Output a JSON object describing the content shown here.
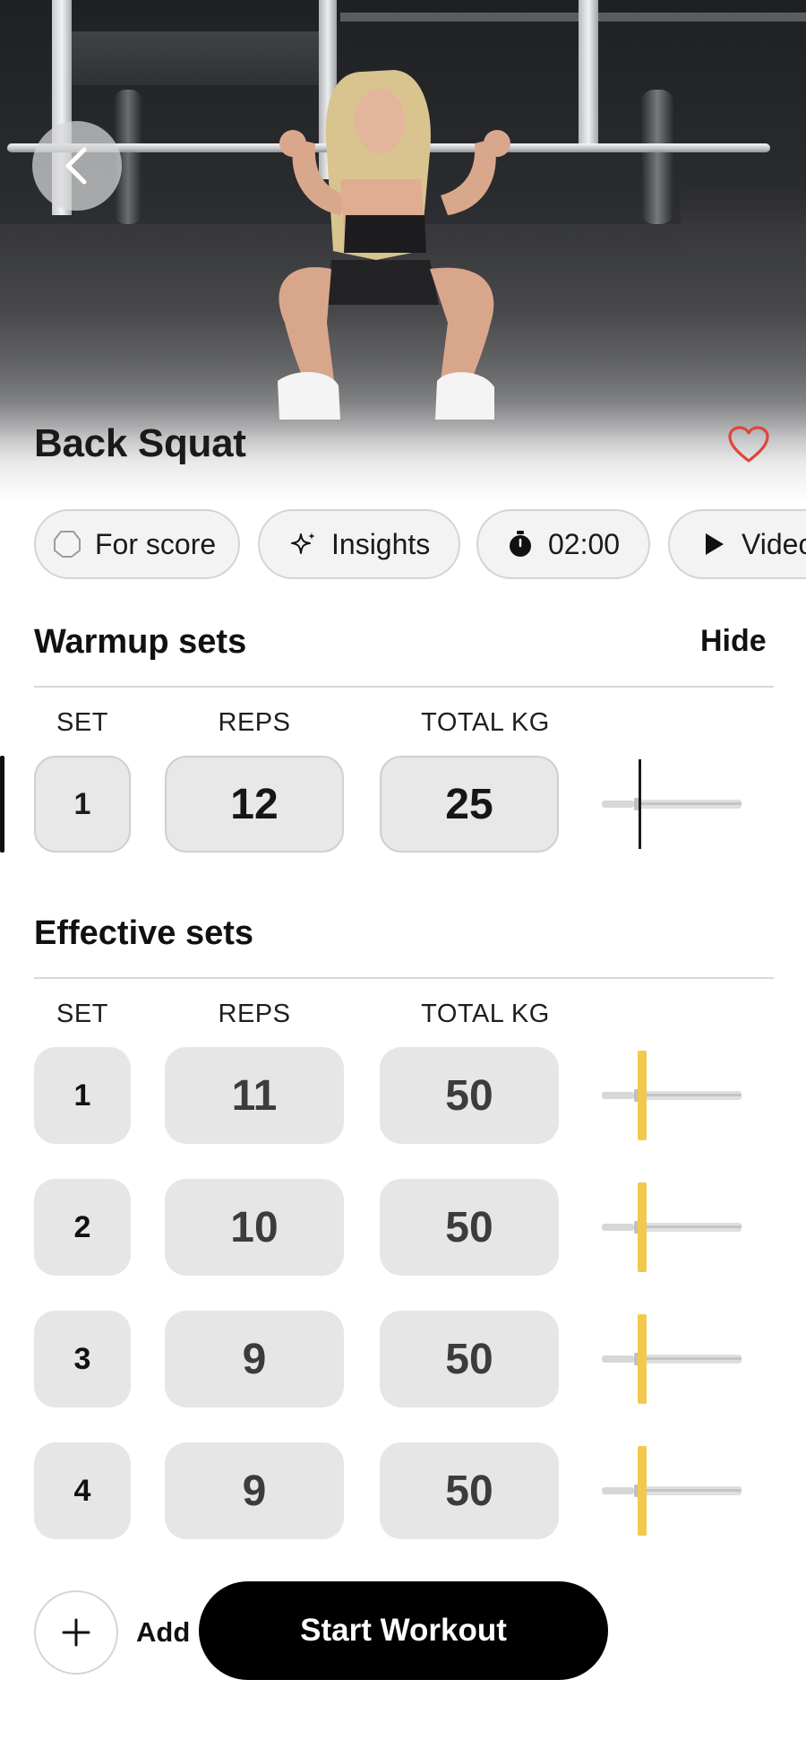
{
  "exercise": {
    "title": "Back Squat",
    "favorite_icon": "heart-outline-icon",
    "accent_color": "#e0463a"
  },
  "chips": [
    {
      "label": "For score",
      "icon": "circle-badge-icon"
    },
    {
      "label": "Insights",
      "icon": "sparkle-icon"
    },
    {
      "label": "02:00",
      "icon": "stopwatch-icon"
    },
    {
      "label": "Video",
      "icon": "play-icon"
    }
  ],
  "warmup": {
    "title": "Warmup sets",
    "hide_label": "Hide",
    "columns": {
      "set": "SET",
      "reps": "REPS",
      "total": "TOTAL KG"
    },
    "rows": [
      {
        "set": "1",
        "reps": "12",
        "total": "25"
      }
    ]
  },
  "effective": {
    "title": "Effective sets",
    "columns": {
      "set": "SET",
      "reps": "REPS",
      "total": "TOTAL KG"
    },
    "plate_color": "#f2c94c",
    "rows": [
      {
        "set": "1",
        "reps": "11",
        "total": "50"
      },
      {
        "set": "2",
        "reps": "10",
        "total": "50"
      },
      {
        "set": "3",
        "reps": "9",
        "total": "50"
      },
      {
        "set": "4",
        "reps": "9",
        "total": "50"
      }
    ]
  },
  "footer": {
    "add_label": "Add",
    "start_label": "Start Workout"
  }
}
